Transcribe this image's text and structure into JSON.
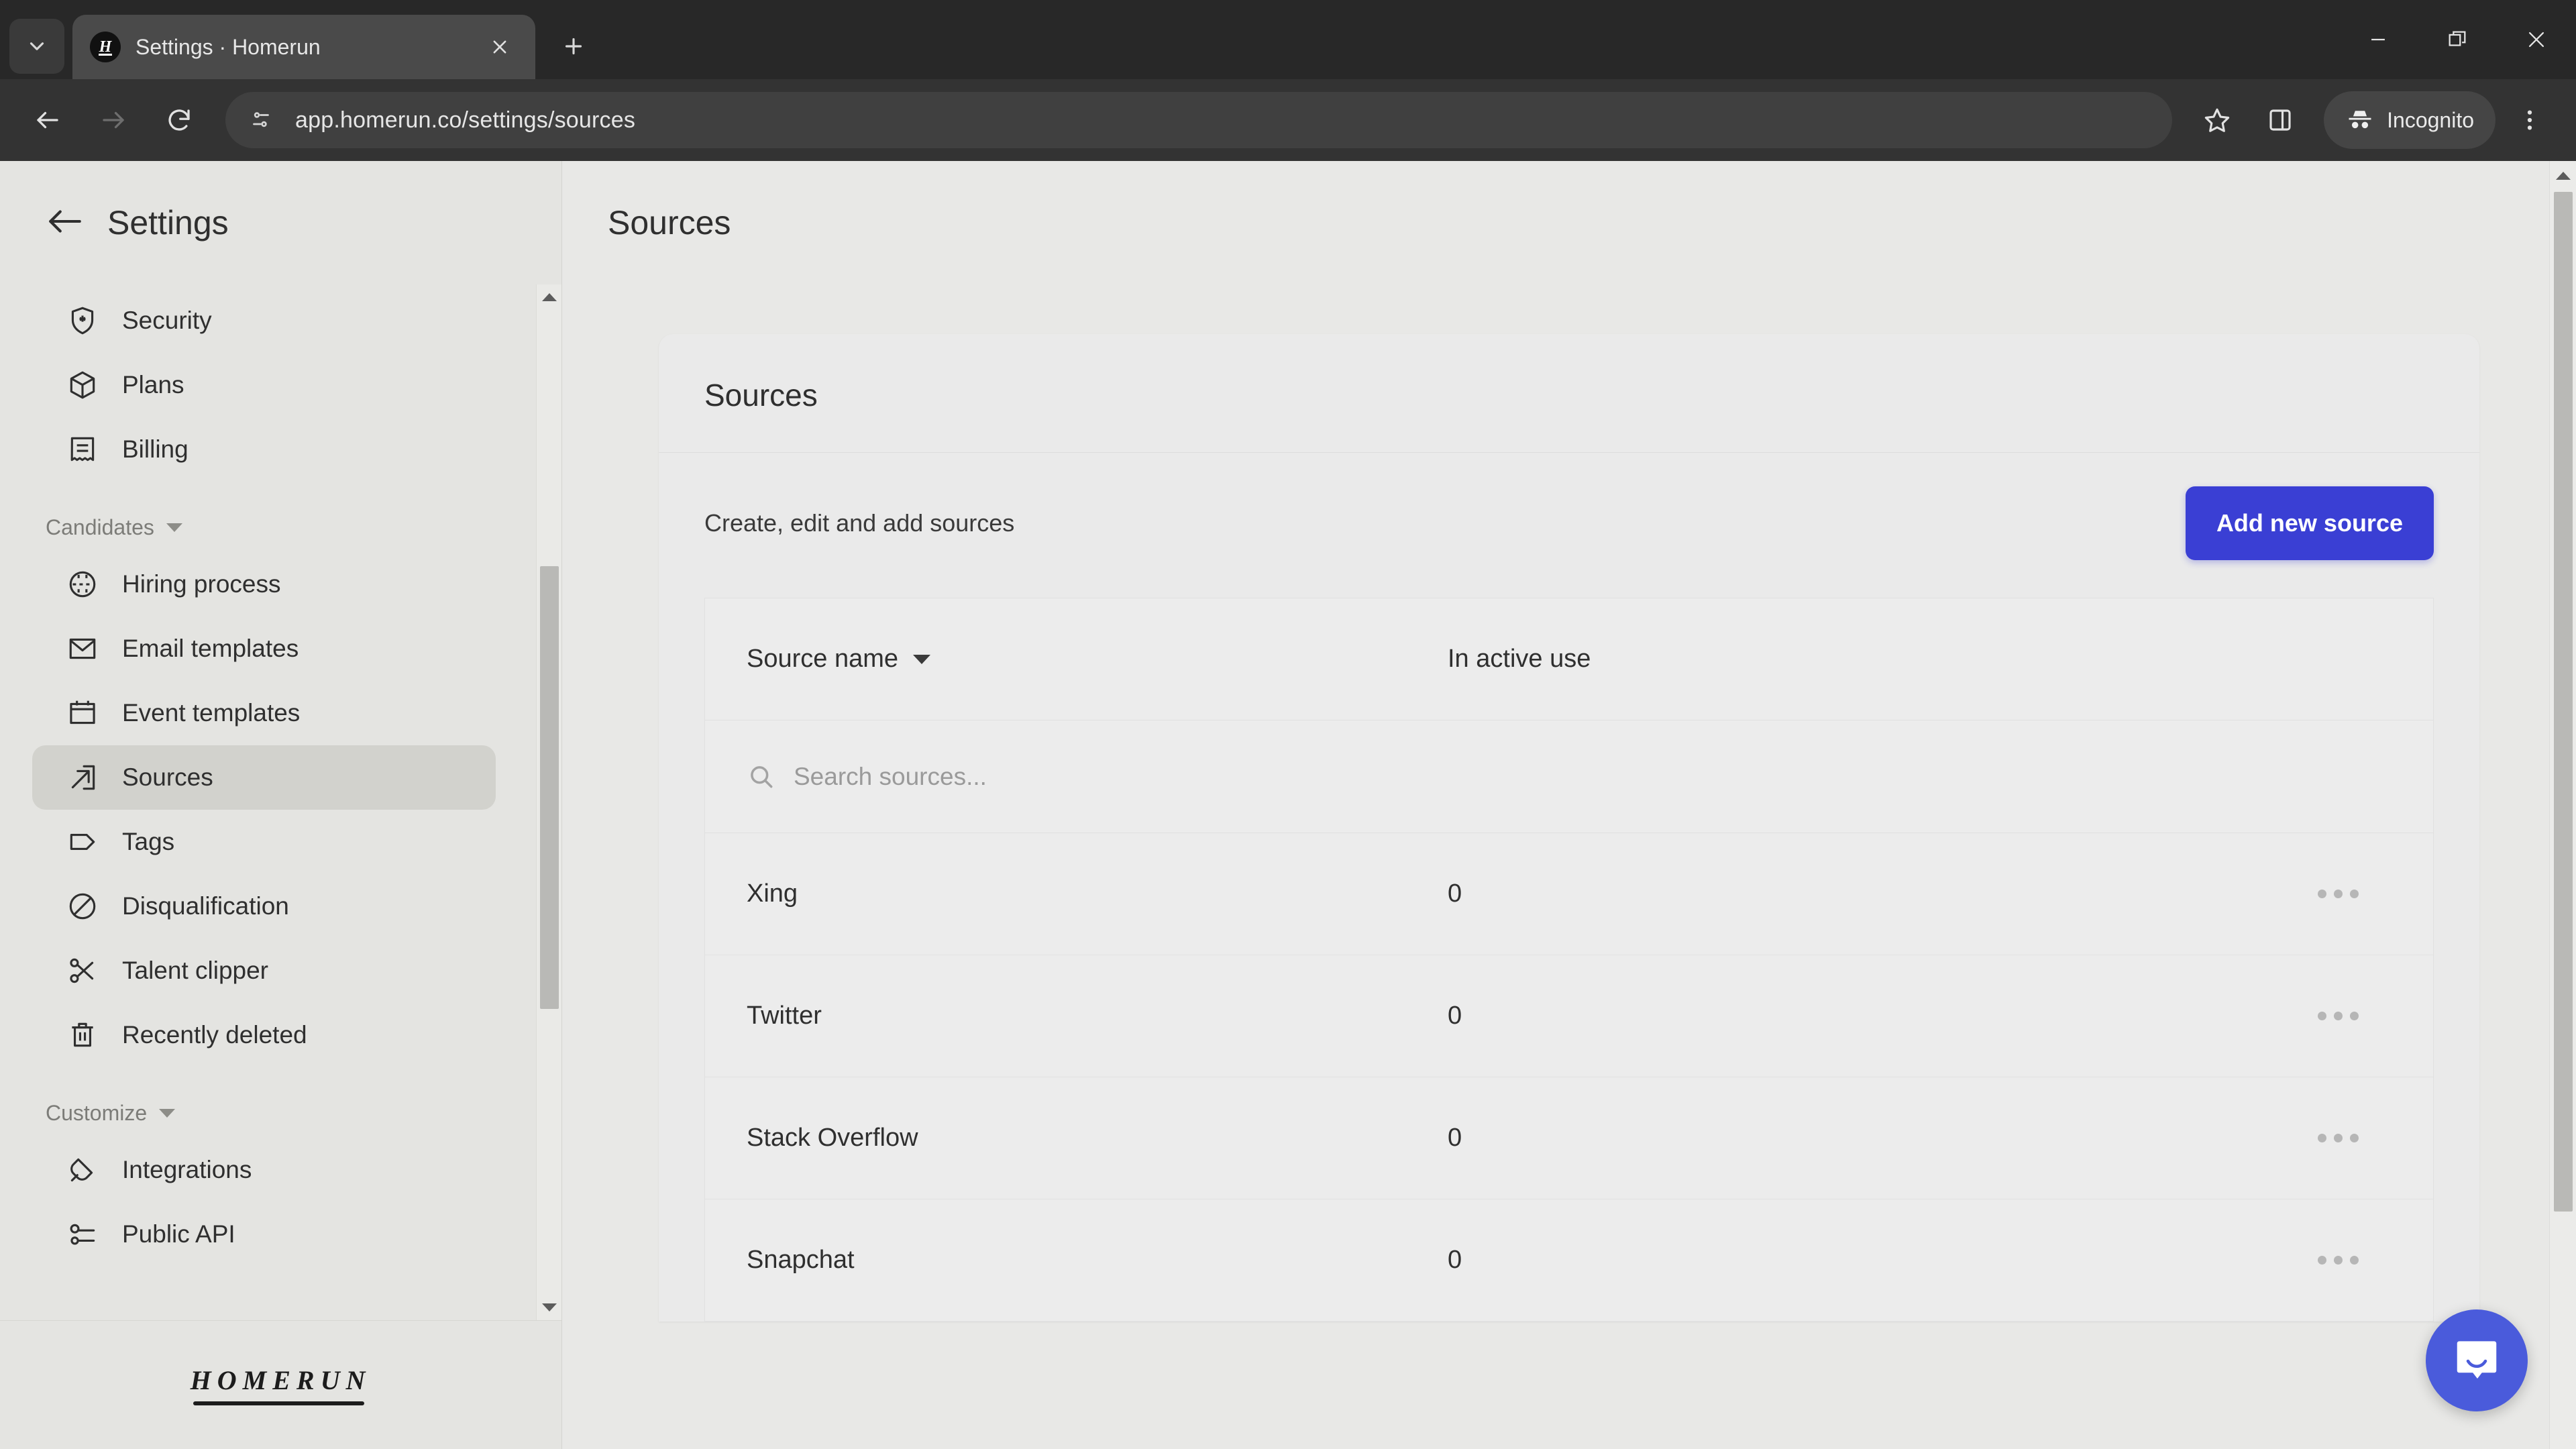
{
  "browser": {
    "tab": {
      "title": "Settings · Homerun",
      "favicon_letter": "H",
      "close_icon": "close-icon",
      "search_tabs_icon": "chevron-down-icon"
    },
    "new_tab_icon": "plus-icon",
    "window_controls": {
      "minimize": "minimize-icon",
      "maximize": "restore-icon",
      "close": "close-icon"
    },
    "toolbar": {
      "back_icon": "arrow-left-icon",
      "forward_icon": "arrow-right-icon",
      "reload_icon": "reload-icon",
      "site_info_icon": "page-settings-icon",
      "url": "app.homerun.co/settings/sources",
      "bookmark_icon": "star-icon",
      "side_panel_icon": "side-panel-icon",
      "profile_label": "Incognito",
      "profile_icon": "incognito-icon",
      "menu_icon": "three-dots-vertical-icon"
    }
  },
  "sidebar": {
    "back_icon": "arrow-left-icon",
    "title": "Settings",
    "items_top": [
      {
        "label": "Security",
        "icon": "shield-star-icon",
        "active": false
      },
      {
        "label": "Plans",
        "icon": "box-icon",
        "active": false
      },
      {
        "label": "Billing",
        "icon": "receipt-icon",
        "active": false
      }
    ],
    "group_candidates": {
      "label": "Candidates",
      "caret_icon": "chevron-down-icon",
      "items": [
        {
          "label": "Hiring process",
          "icon": "flow-circle-icon",
          "active": false
        },
        {
          "label": "Email templates",
          "icon": "envelope-icon",
          "active": false
        },
        {
          "label": "Event templates",
          "icon": "calendar-icon",
          "active": false
        },
        {
          "label": "Sources",
          "icon": "arrow-out-box-icon",
          "active": true
        },
        {
          "label": "Tags",
          "icon": "tag-icon",
          "active": false
        },
        {
          "label": "Disqualification",
          "icon": "no-entry-icon",
          "active": false
        },
        {
          "label": "Talent clipper",
          "icon": "scissors-icon",
          "active": false
        },
        {
          "label": "Recently deleted",
          "icon": "trash-icon",
          "active": false
        }
      ]
    },
    "group_customize": {
      "label": "Customize",
      "caret_icon": "chevron-down-icon",
      "items": [
        {
          "label": "Integrations",
          "icon": "plug-icon",
          "active": false
        },
        {
          "label": "Public API",
          "icon": "api-key-icon",
          "active": false
        }
      ]
    },
    "brand": "HOMERUN",
    "scrollbar": {
      "up_icon": "triangle-up-icon",
      "down_icon": "triangle-down-icon"
    }
  },
  "main": {
    "page_title": "Sources",
    "card": {
      "title": "Sources",
      "subtitle": "Create, edit and add sources",
      "add_button": "Add new source",
      "accent_color": "#3a3fd4"
    },
    "table": {
      "columns": [
        "Source name",
        "In active use"
      ],
      "sort_icon": "caret-down-icon",
      "search": {
        "placeholder": "Search sources...",
        "value": "",
        "icon": "search-icon"
      },
      "row_menu_icon": "three-dots-horizontal-icon",
      "rows": [
        {
          "name": "Xing",
          "in_active_use": "0"
        },
        {
          "name": "Twitter",
          "in_active_use": "0"
        },
        {
          "name": "Stack Overflow",
          "in_active_use": "0"
        },
        {
          "name": "Snapchat",
          "in_active_use": "0"
        }
      ]
    },
    "scrollbar": {
      "up_icon": "triangle-up-icon"
    },
    "intercom": {
      "icon": "chat-bubble-icon",
      "color": "#4a5bdb"
    }
  }
}
